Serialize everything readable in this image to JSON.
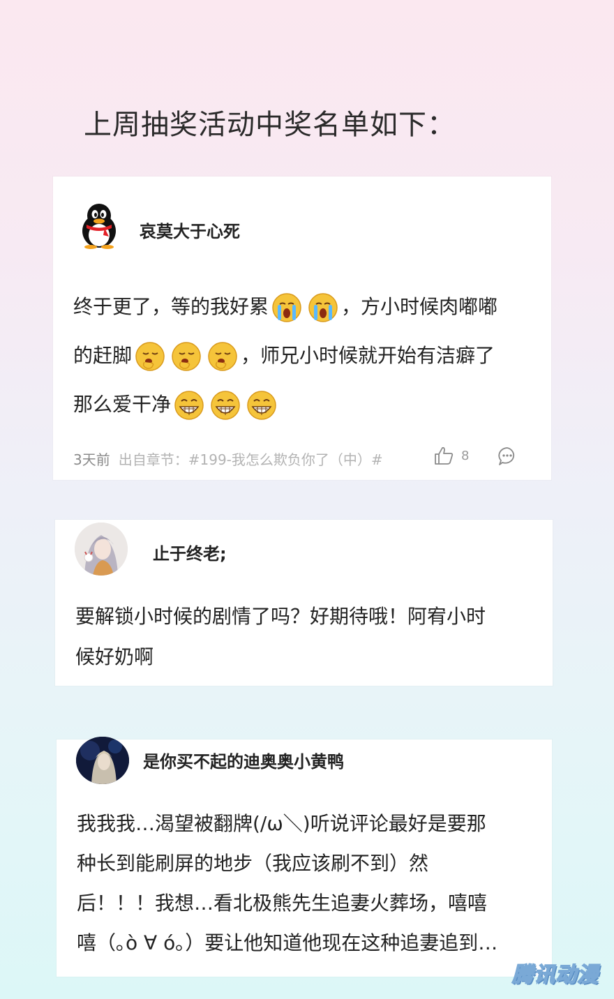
{
  "page": {
    "title": "上周抽奖活动中奖名单如下："
  },
  "comments": [
    {
      "username": "哀莫大于心死",
      "avatar_icon": "qq-penguin-icon",
      "lines": [
        {
          "segments": [
            "终于更了，等的我好累",
            "，方小时候肉嘟嘟"
          ]
        },
        {
          "segments": [
            "的赶脚",
            "，师兄小时候就开始有洁癖了"
          ]
        },
        {
          "segments": [
            "那么爱干净"
          ]
        }
      ],
      "emoji_groups": [
        "crying-face-icon",
        "yawning-face-icon",
        "grinning-face-icon"
      ],
      "time": "3天前",
      "source": "出自章节：#199-我怎么欺负你了（中）#",
      "likes": "8",
      "like_icon": "thumbs-up-icon",
      "reply_icon": "comment-bubble-icon"
    },
    {
      "username": "止于终老;",
      "avatar_icon": "anime-character-avatar",
      "lines": [
        "要解锁小时候的剧情了吗？好期待哦！阿宥小时",
        "候好奶啊"
      ]
    },
    {
      "username": "是你买不起的迪奥奥小黄鸭",
      "avatar_icon": "dark-portrait-avatar",
      "lines": [
        "我我我…渴望被翻牌(/ω＼)听说评论最好是要那",
        "种长到能刷屏的地步（我应该刷不到）然",
        "后！！！我想…看北极熊先生追妻火葬场，嘻嘻",
        "嘻（｡ò ∀ ó｡）要让他知道他现在这种追妻追到…"
      ]
    }
  ],
  "watermark": "腾讯动漫",
  "colors": {
    "bg_top": "#fbe8f0",
    "bg_bottom": "#dcf7f7",
    "card": "#ffffff",
    "meta_text": "#9a9a9a",
    "emoji_yellow": "#f5c43a"
  }
}
